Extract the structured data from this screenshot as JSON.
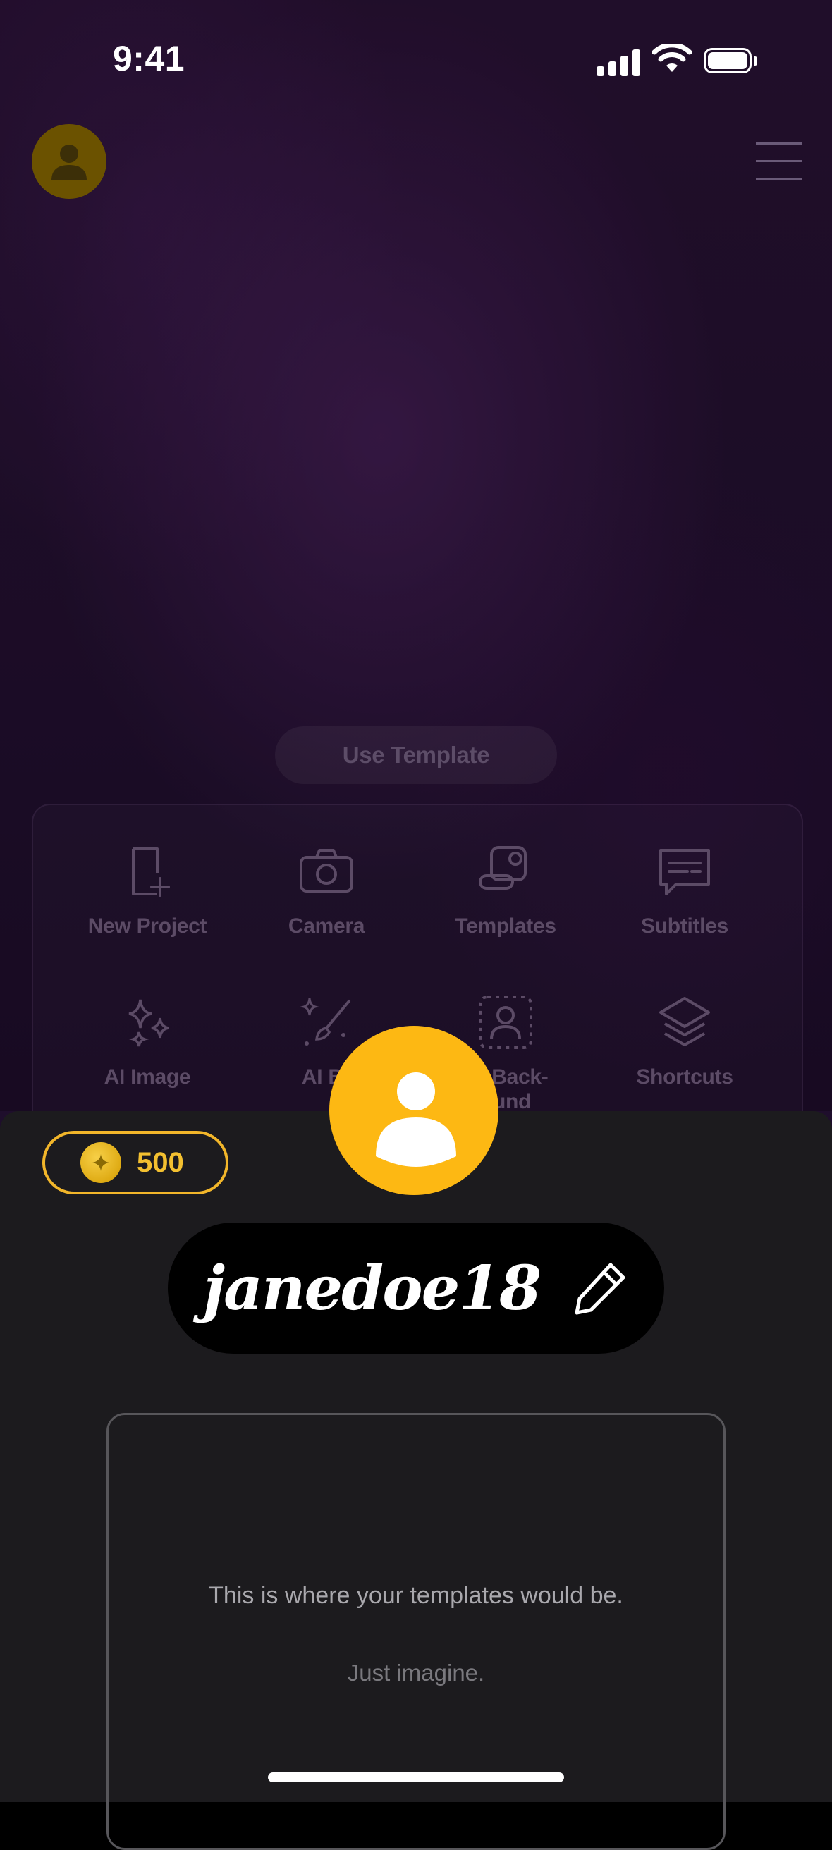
{
  "status_bar": {
    "time": "9:41"
  },
  "home": {
    "use_template_label": "Use Template",
    "tools": [
      {
        "label": "New Project",
        "icon": "new-project-icon"
      },
      {
        "label": "Camera",
        "icon": "camera-icon"
      },
      {
        "label": "Templates",
        "icon": "templates-icon"
      },
      {
        "label": "Subtitles",
        "icon": "subtitles-icon"
      },
      {
        "label": "AI Image",
        "icon": "sparkles-icon"
      },
      {
        "label": "AI Br",
        "icon": "ai-brush-icon"
      },
      {
        "label": "ve Back-\nound",
        "icon": "remove-background-icon"
      },
      {
        "label": "Shortcuts",
        "icon": "layers-icon"
      }
    ]
  },
  "profile_sheet": {
    "coins": "500",
    "username": "janedoe18",
    "empty_message": "This is where your templates would be.",
    "empty_submessage": "Just imagine."
  },
  "colors": {
    "accent_yellow": "#fdb813",
    "coin_text": "#f3c030",
    "sheet_bg": "#1c1b1e",
    "background_purple": "#2a1236"
  }
}
